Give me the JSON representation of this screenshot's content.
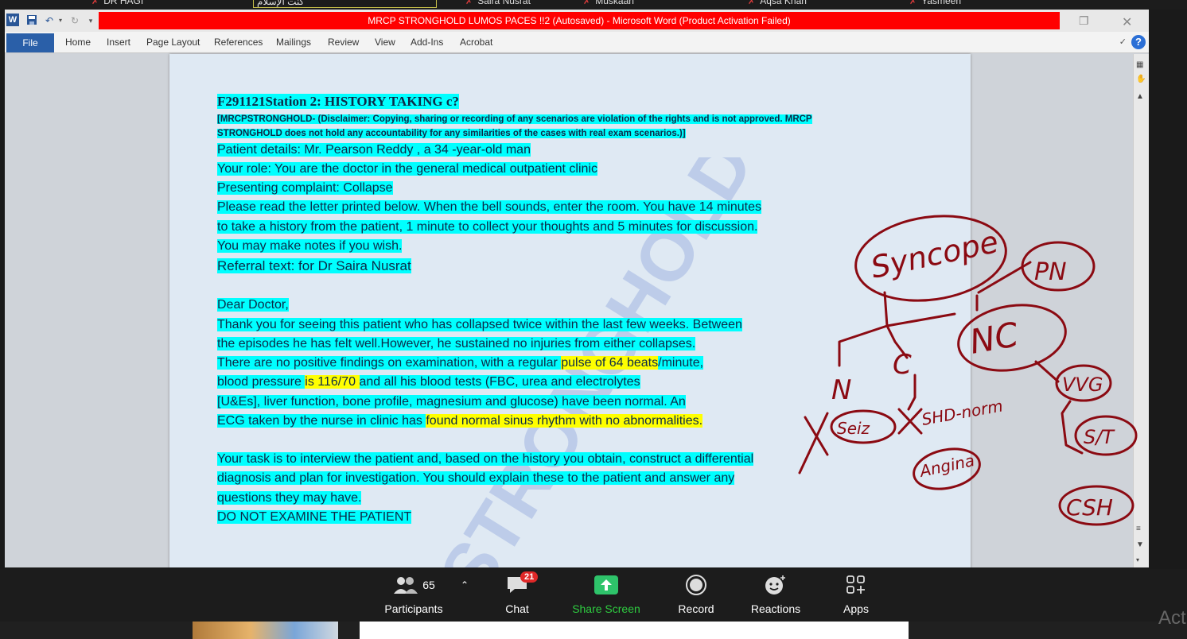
{
  "participants_strip": [
    {
      "name": "DR HAGI",
      "x_hint": "a"
    },
    {
      "name": "كنت الإسلام",
      "x_hint": "b"
    },
    {
      "name": "Saira Nusrat",
      "x_hint": "c"
    },
    {
      "name": "Muskaan",
      "x_hint": "d"
    },
    {
      "name": "Aqsa Khan",
      "x_hint": "e"
    },
    {
      "name": "Yasmeen",
      "x_hint": "f"
    }
  ],
  "word": {
    "title": "MRCP STRONGHOLD LUMOS PACES !!2 (Autosaved) - Microsoft Word (Product Activation Failed)",
    "tabs": [
      "File",
      "Home",
      "Insert",
      "Page Layout",
      "References",
      "Mailings",
      "Review",
      "View",
      "Add-Ins",
      "Acrobat"
    ]
  },
  "document": {
    "title": "F291121Station  2: HISTORY TAKING c?",
    "disclaimer_1": "[MRCPSTRONGHOLD- (Disclaimer: Copying, sharing or recording of any scenarios are violation of the rights and is not approved. MRCP",
    "disclaimer_2": "STRONGHOLD does not hold any accountability for any similarities of the cases with real exam scenarios.)]",
    "patient_details": "Patient details: Mr. Pearson Reddy , a 34 -year-old man",
    "role": "Your role: You are the doctor in the general medical outpatient clinic",
    "complaint": "Presenting  complaint:  Collapse",
    "instr_1": "Please read the letter printed below. When the bell sounds, enter the room. You have 14 minutes",
    "instr_2": "to take a history from the patient, 1 minute to collect your thoughts and 5 minutes for discussion.",
    "instr_3": "You may make notes if you wish.",
    "referral": "Referral text: for Dr Saira Nusrat",
    "dear": "Dear Doctor,",
    "letter_1": "Thank you for seeing this patient  who has collapsed twice within the last few weeks. Between",
    "letter_2": "the episodes he has felt well.However,  he sustained no injuries from either collapses.",
    "letter_3a": "There are no positive findings on examination, with a regular ",
    "letter_3b": "pulse of 64 beats",
    "letter_3c": "/minute,",
    "letter_4a": "blood pressure ",
    "letter_4b": "is 116/70 ",
    "letter_4c": " and all his blood tests (FBC, urea and electrolytes",
    "letter_5": "[U&Es], liver function, bone profile, magnesium and glucose) have been normal. An",
    "letter_6a": "ECG taken by the nurse in clinic has ",
    "letter_6b": "found normal sinus rhythm with no abnormalities.",
    "task_1": "Your task is to interview the patient and, based on the history you obtain, construct a differential",
    "task_2": "diagnosis and plan for investigation. You should explain these to the patient and answer any",
    "task_3": "questions they may have.",
    "no_exam": "DO NOT EXAMINE THE PATIENT",
    "watermark": "STRONGHOLD PACES"
  },
  "annotations": {
    "syncope": "Syncope",
    "pn": "PN",
    "nc": "NC",
    "n": "N",
    "c": "C",
    "seiz": "Seiz",
    "shd": "SHD-norm",
    "angina": "Angina",
    "vvg": "VVG",
    "st": "S/T",
    "csh": "CSH",
    "color": "#8b0a12"
  },
  "zoom_toolbar": {
    "participants_count": "65",
    "participants": "Participants",
    "chat": "Chat",
    "chat_badge": "21",
    "share_screen": "Share Screen",
    "record": "Record",
    "reactions": "Reactions",
    "apps": "Apps"
  },
  "activation_partial": "Act"
}
